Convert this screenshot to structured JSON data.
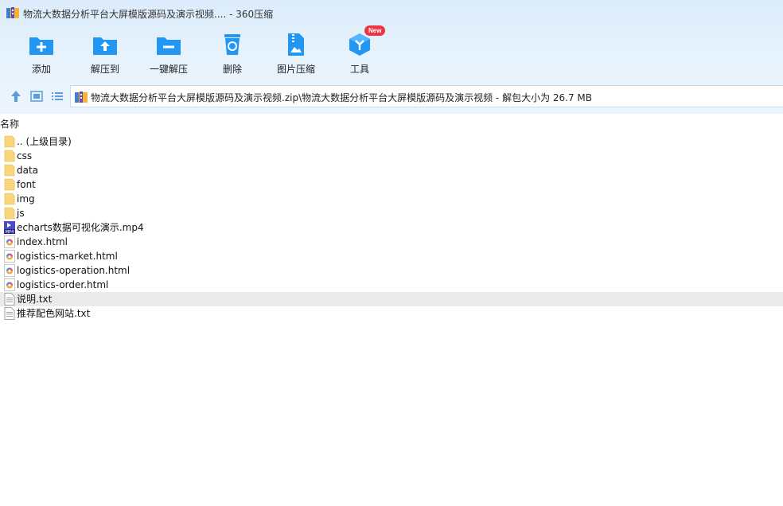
{
  "window": {
    "title": "物流大数据分析平台大屏模版源码及演示视频.... - 360压缩"
  },
  "toolbar": {
    "add": "添加",
    "extract_to": "解压到",
    "one_click_extract": "一键解压",
    "delete": "删除",
    "image_compress": "图片压缩",
    "tools": "工具",
    "tools_badge": "New"
  },
  "address": {
    "path": "物流大数据分析平台大屏模版源码及演示视频.zip\\物流大数据分析平台大屏模版源码及演示视频 - 解包大小为 26.7 MB"
  },
  "list": {
    "column_name": "名称",
    "items": [
      {
        "name": ".. (上级目录)",
        "type": "folder"
      },
      {
        "name": "css",
        "type": "folder"
      },
      {
        "name": "data",
        "type": "folder"
      },
      {
        "name": "font",
        "type": "folder"
      },
      {
        "name": "img",
        "type": "folder"
      },
      {
        "name": "js",
        "type": "folder"
      },
      {
        "name": "echarts数据可视化演示.mp4",
        "type": "mp4"
      },
      {
        "name": "index.html",
        "type": "html"
      },
      {
        "name": "logistics-market.html",
        "type": "html"
      },
      {
        "name": "logistics-operation.html",
        "type": "html"
      },
      {
        "name": "logistics-order.html",
        "type": "html"
      },
      {
        "name": "说明.txt",
        "type": "txt"
      },
      {
        "name": "推荐配色网站.txt",
        "type": "txt"
      }
    ]
  },
  "colors": {
    "accent_blue": "#2196f3",
    "folder_yellow": "#f9d77a",
    "badge_red": "#ee3344",
    "selected_row": "#ebebeb"
  }
}
